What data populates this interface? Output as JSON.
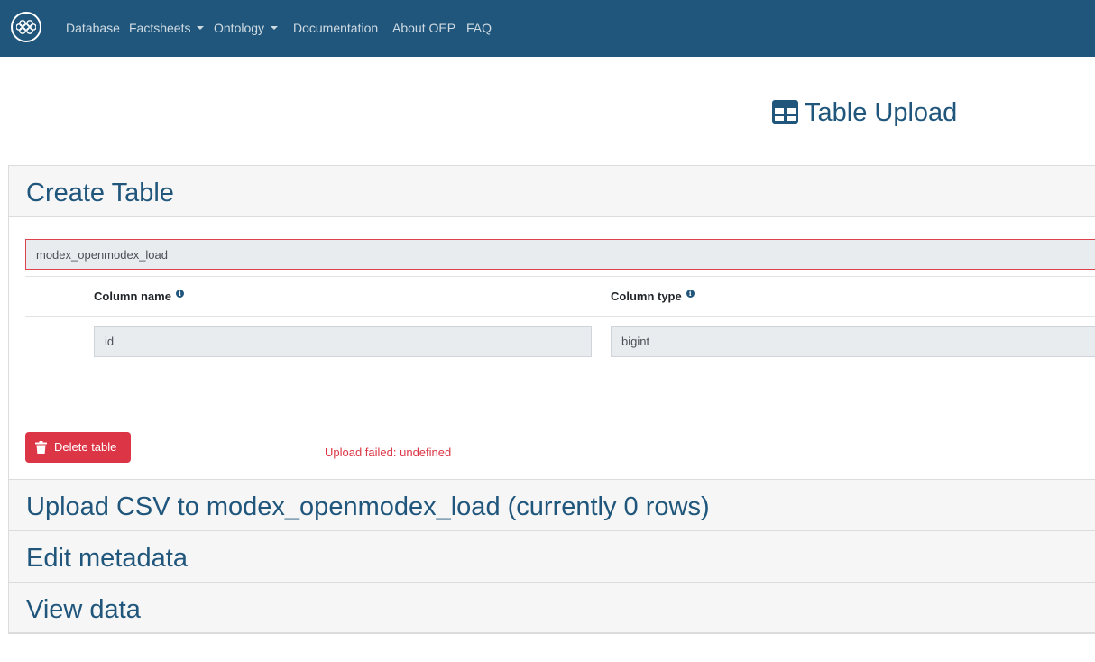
{
  "nav": {
    "items": [
      {
        "label": "Database"
      },
      {
        "label": "Factsheets"
      },
      {
        "label": "Ontology"
      },
      {
        "label": "Documentation"
      },
      {
        "label": "About OEP"
      },
      {
        "label": "FAQ"
      }
    ]
  },
  "page": {
    "title": "Table Upload"
  },
  "create_table": {
    "heading": "Create Table",
    "table_name_value": "modex_openmodex_load",
    "columns_header": {
      "name": "Column name",
      "type": "Column type"
    },
    "columns": [
      {
        "name": "id",
        "type": "bigint"
      }
    ],
    "delete_label": "Delete table",
    "error_message": "Upload failed: undefined"
  },
  "sections": {
    "upload_csv": "Upload CSV to modex_openmodex_load (currently 0 rows)",
    "edit_metadata": "Edit metadata",
    "view_data": "View data"
  },
  "colors": {
    "navbar": "#20567c",
    "accent": "#20567c",
    "danger": "#dc3545"
  }
}
